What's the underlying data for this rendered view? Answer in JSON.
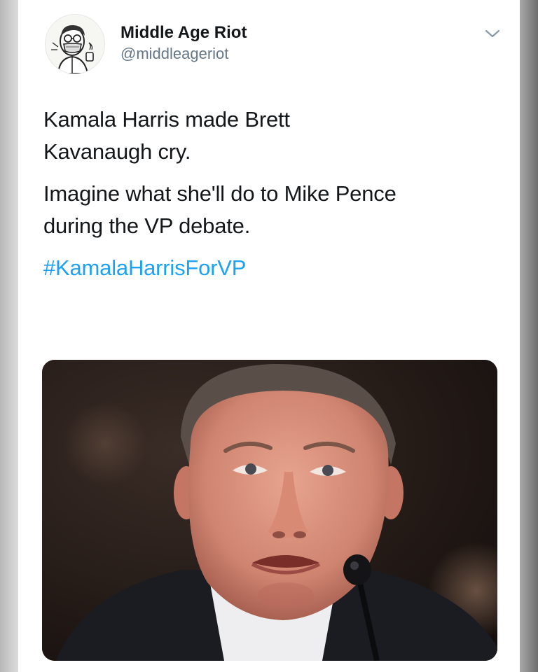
{
  "tweet": {
    "author": {
      "display_name": "Middle Age Riot",
      "handle": "@middleageriot",
      "avatar_icon": "cartoon-face-avatar"
    },
    "menu_icon": "chevron-down-icon",
    "paragraphs": [
      "Kamala Harris made Brett\nKavanaugh cry.",
      "Imagine what she'll do to Mike Pence\nduring the VP debate."
    ],
    "hashtag": "#KamalaHarrisForVP",
    "media": {
      "description_icon": "photo-of-man-crying"
    }
  },
  "colors": {
    "text": "#14171a",
    "muted": "#657786",
    "link": "#1da1f2",
    "background": "#ffffff"
  }
}
